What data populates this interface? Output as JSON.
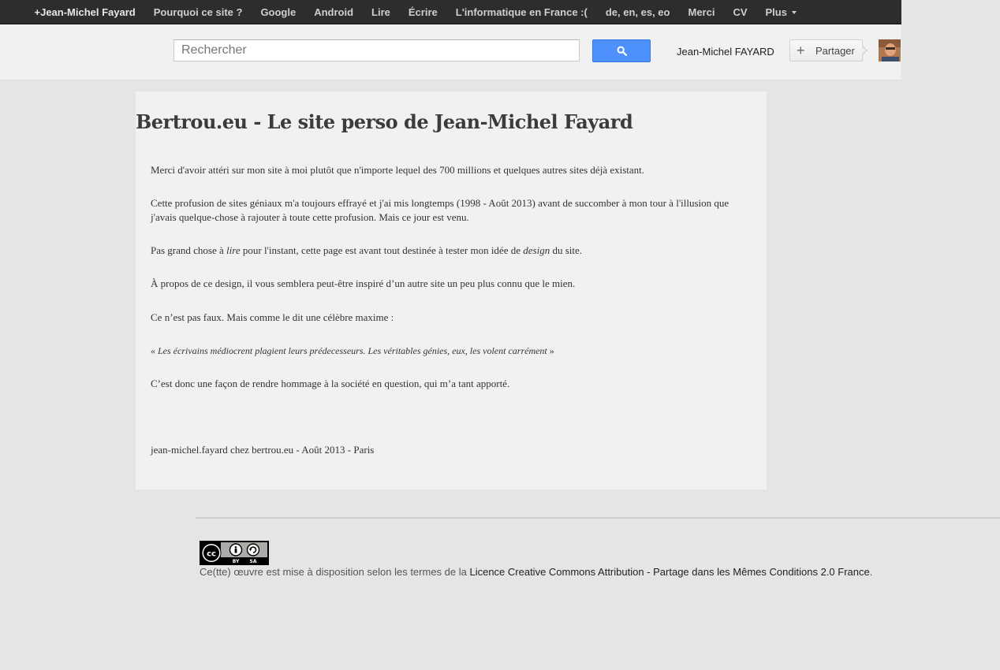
{
  "nav": {
    "items": [
      {
        "label": "+Jean-Michel Fayard"
      },
      {
        "label": "Pourquoi ce site ?"
      },
      {
        "label": "Google"
      },
      {
        "label": "Android"
      },
      {
        "label": "Lire"
      },
      {
        "label": "Écrire"
      },
      {
        "label": "L'informatique en France :("
      },
      {
        "label": "de, en, es, eo"
      },
      {
        "label": "Merci"
      },
      {
        "label": "CV"
      },
      {
        "label": "Plus"
      }
    ]
  },
  "header": {
    "search_placeholder": "Rechercher",
    "user_name": "Jean-Michel FAYARD",
    "share_label": "Partager",
    "search_button_color": "#4d90fe"
  },
  "article": {
    "title": "Bertrou.eu - Le site perso de Jean-Michel Fayard",
    "p1": "Merci d'avoir attéri sur mon site à moi plutôt que n'importe lequel des 700 millions et quelques autres sites déjà existant.",
    "p2": "Cette profusion de sites géniaux m'a toujours effrayé et j'ai mis longtemps (1998 - Août 2013) avant de succomber à mon tour à l'illusion que j'avais quelque-chose à rajouter à toute cette profusion. Mais ce jour est venu.",
    "p3_before": "Pas grand chose à ",
    "p3_em1": "lire",
    "p3_middle": " pour l'instant, cette page est avant tout destinée à tester mon idée de ",
    "p3_em2": "design",
    "p3_after": " du site.",
    "p4": "À propos de ce design, il vous semblera peut-être inspiré d’un autre site un peu plus connu que le mien.",
    "p5": "Ce n’est pas faux. Mais comme le dit une célèbre maxime :",
    "quote_open": "« ",
    "quote_text": "Les écrivains médiocrent plagient leurs prédecesseurs. Les véritables génies, eux, les volent carrément",
    "quote_close": " »",
    "p6": "C’est donc une façon de rendre hommage à la société en question, qui m’a tant apporté.",
    "signature": "jean-michel.fayard chez bertrou.eu - Août 2013 - Paris"
  },
  "footer": {
    "badge_icon": "creative-commons-by-sa-badge",
    "badge_by": "BY",
    "badge_sa": "SA",
    "text_prefix": "Ce(tte) œuvre est mise à disposition selon les termes de la ",
    "license_link": "Licence Creative Commons Attribution - Partage dans les Mêmes Conditions 2.0 France",
    "text_suffix": "."
  }
}
